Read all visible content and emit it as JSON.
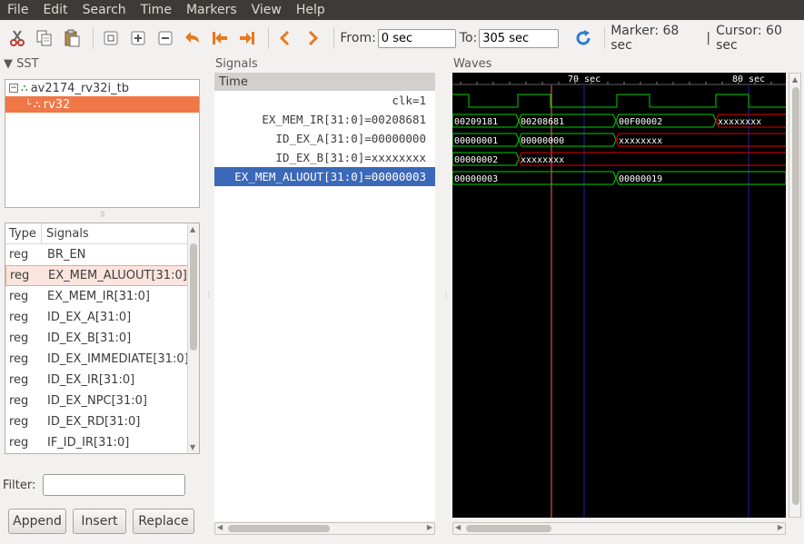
{
  "menu": [
    "File",
    "Edit",
    "Search",
    "Time",
    "Markers",
    "View",
    "Help"
  ],
  "toolbar": {
    "icons": [
      "cut-icon",
      "copy-icon",
      "paste-icon",
      "zoom-fit-icon",
      "zoom-in-icon",
      "zoom-out-icon",
      "undo-zoom-icon",
      "zoom-to-start-icon",
      "zoom-to-end-icon",
      "prev-edge-icon",
      "next-edge-icon",
      "reload-icon"
    ],
    "from_label": "From:",
    "from_value": "0 sec",
    "to_label": "To:",
    "to_value": "305 sec",
    "marker_text": "Marker: 68 sec",
    "separator": "|",
    "cursor_text": "Cursor: 60 sec"
  },
  "sst": {
    "title": "SST",
    "tree": [
      {
        "label": "av2174_rv32i_tb",
        "selected": false
      },
      {
        "label": "rv32",
        "selected": true
      }
    ],
    "columns": {
      "type": "Type",
      "name": "Signals"
    },
    "signals": [
      {
        "type": "reg",
        "name": "BR_EN"
      },
      {
        "type": "reg",
        "name": "EX_MEM_ALUOUT[31:0]"
      },
      {
        "type": "reg",
        "name": "EX_MEM_IR[31:0]"
      },
      {
        "type": "reg",
        "name": "ID_EX_A[31:0]"
      },
      {
        "type": "reg",
        "name": "ID_EX_B[31:0]"
      },
      {
        "type": "reg",
        "name": "ID_EX_IMMEDIATE[31:0]"
      },
      {
        "type": "reg",
        "name": "ID_EX_IR[31:0]"
      },
      {
        "type": "reg",
        "name": "ID_EX_NPC[31:0]"
      },
      {
        "type": "reg",
        "name": "ID_EX_RD[31:0]"
      },
      {
        "type": "reg",
        "name": "IF_ID_IR[31:0]"
      }
    ],
    "filter_label": "Filter:",
    "filter_value": "",
    "buttons": {
      "append": "Append",
      "insert": "Insert",
      "replace": "Replace"
    }
  },
  "signals_panel": {
    "title": "Signals",
    "time_header": "Time",
    "rows": [
      {
        "text": "clk=1",
        "selected": false
      },
      {
        "text": "EX_MEM_IR[31:0]=00208681",
        "selected": false
      },
      {
        "text": "ID_EX_A[31:0]=00000000",
        "selected": false
      },
      {
        "text": "ID_EX_B[31:0]=xxxxxxxx",
        "selected": false
      },
      {
        "text": "EX_MEM_ALUOUT[31:0]=00000003",
        "selected": true
      }
    ]
  },
  "waves": {
    "title": "Waves",
    "time_labels": [
      "70 sec",
      "80 sec"
    ],
    "bus_values": {
      "ex_mem_ir": [
        "00209181",
        "00208681",
        "00F00002",
        "xxxxxxxx"
      ],
      "id_ex_a": [
        "00000001",
        "00000000",
        "xxxxxxxx"
      ],
      "id_ex_b": [
        "00000002",
        "xxxxxxxx"
      ],
      "ex_mem_aluout": [
        "00000003",
        "00000019"
      ]
    },
    "colors": {
      "bus": "#00d000",
      "unknown": "#e00000",
      "marker": "#ff6060",
      "grid": "#2020a0",
      "ruler": "#ffffff"
    }
  }
}
